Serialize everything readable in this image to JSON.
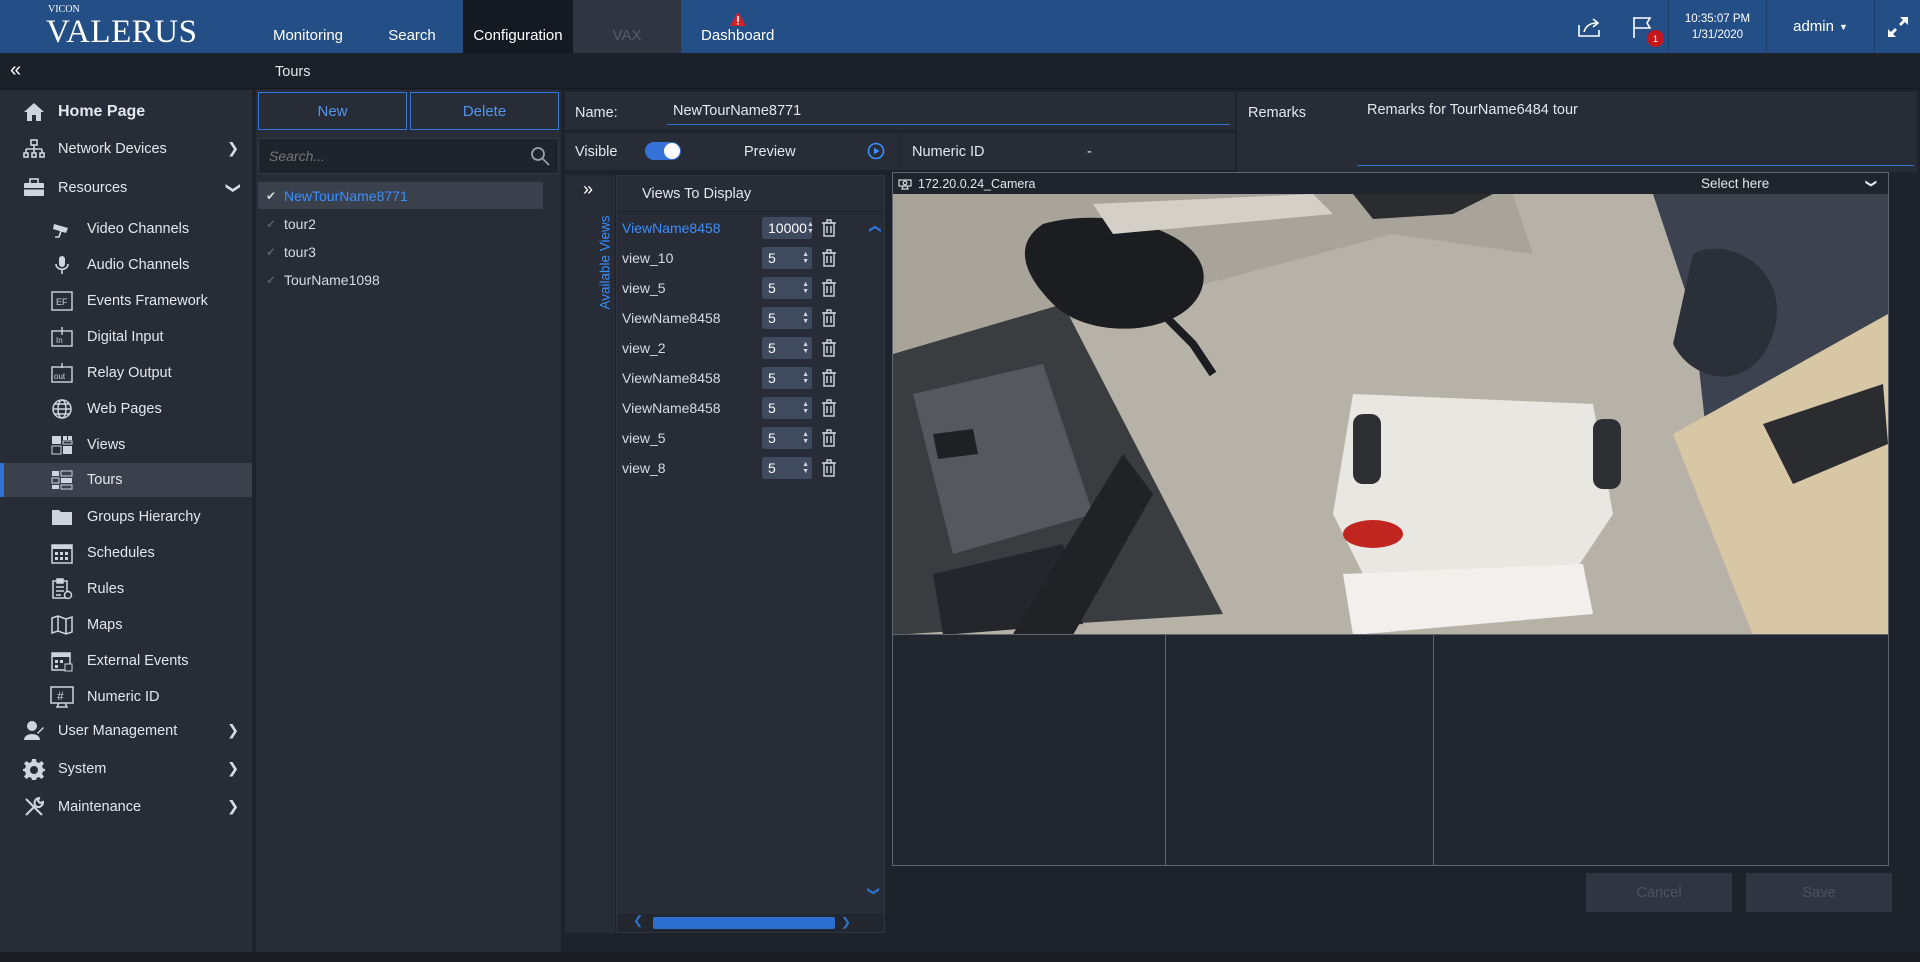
{
  "brand": {
    "small": "VICON",
    "big": "VALERUS"
  },
  "nav": {
    "monitoring": "Monitoring",
    "search": "Search",
    "configuration": "Configuration",
    "vax": "VAX",
    "dashboard": "Dashboard"
  },
  "topright": {
    "flag_badge": "1",
    "time": "10:35:07 PM",
    "date": "1/31/2020",
    "user": "admin"
  },
  "breadcrumb": "Tours",
  "sidebar": {
    "home": "Home Page",
    "network_devices": "Network Devices",
    "resources": "Resources",
    "items": [
      "Video Channels",
      "Audio Channels",
      "Events Framework",
      "Digital Input",
      "Relay Output",
      "Web Pages",
      "Views",
      "Tours",
      "Groups Hierarchy",
      "Schedules",
      "Rules",
      "Maps",
      "External Events",
      "Numeric ID"
    ],
    "user_management": "User Management",
    "system": "System",
    "maintenance": "Maintenance"
  },
  "list": {
    "new_label": "New",
    "delete_label": "Delete",
    "search_placeholder": "Search...",
    "tours": [
      "NewTourName8771",
      "tour2",
      "tour3",
      "TourName1098"
    ]
  },
  "form": {
    "name_label": "Name:",
    "name_value": "NewTourName8771",
    "remarks_label": "Remarks",
    "remarks_value": "Remarks for TourName6484 tour",
    "visible_label": "Visible",
    "visible_on": true,
    "preview_label": "Preview",
    "numeric_id_label": "Numeric ID",
    "numeric_id_value": "-"
  },
  "views": {
    "available_label": "Available Views",
    "header": "Views To Display",
    "rows": [
      {
        "name": "ViewName8458",
        "dwell": "10000"
      },
      {
        "name": "view_10",
        "dwell": "5"
      },
      {
        "name": "view_5",
        "dwell": "5"
      },
      {
        "name": "ViewName8458",
        "dwell": "5"
      },
      {
        "name": "view_2",
        "dwell": "5"
      },
      {
        "name": "ViewName8458",
        "dwell": "5"
      },
      {
        "name": "ViewName8458",
        "dwell": "5"
      },
      {
        "name": "view_5",
        "dwell": "5"
      },
      {
        "name": "view_8",
        "dwell": "5"
      }
    ]
  },
  "camera": {
    "title": "172.20.0.24_Camera",
    "select": "Select here"
  },
  "actions": {
    "cancel": "Cancel",
    "save": "Save"
  },
  "colors": {
    "accent": "#2d73d2",
    "topbar": "#244f86",
    "badge": "#c4161c"
  }
}
